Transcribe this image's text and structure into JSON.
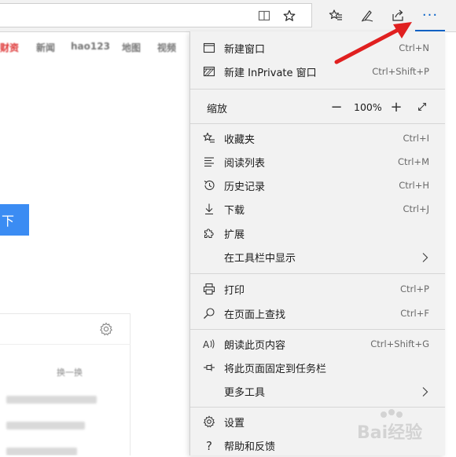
{
  "toolbar": {
    "icons": [
      "reading-view-icon",
      "favorite-star-icon",
      "favorites-hub-icon",
      "pen-icon",
      "share-icon",
      "more-icon"
    ],
    "more_label": "···"
  },
  "page": {
    "tabs": [
      "财资",
      "新闻",
      "hao123",
      "地图",
      "视频"
    ],
    "blue_button_label": "下",
    "refresh_label": "换一换"
  },
  "menu": {
    "items": [
      {
        "label": "新建窗口",
        "shortcut": "Ctrl+N",
        "icon": "window-icon"
      },
      {
        "label": "新建 InPrivate 窗口",
        "shortcut": "Ctrl+Shift+P",
        "icon": "inprivate-icon"
      },
      {
        "label": "收藏夹",
        "shortcut": "Ctrl+I",
        "icon": "favorites-icon"
      },
      {
        "label": "阅读列表",
        "shortcut": "Ctrl+M",
        "icon": "reading-list-icon"
      },
      {
        "label": "历史记录",
        "shortcut": "Ctrl+H",
        "icon": "history-icon"
      },
      {
        "label": "下载",
        "shortcut": "Ctrl+J",
        "icon": "download-icon"
      },
      {
        "label": "扩展",
        "shortcut": "",
        "icon": "extensions-icon"
      },
      {
        "label": "在工具栏中显示",
        "shortcut": "",
        "icon": ""
      },
      {
        "label": "打印",
        "shortcut": "Ctrl+P",
        "icon": "print-icon"
      },
      {
        "label": "在页面上查找",
        "shortcut": "Ctrl+F",
        "icon": "find-icon"
      },
      {
        "label": "朗读此页内容",
        "shortcut": "Ctrl+Shift+G",
        "icon": "read-aloud-icon"
      },
      {
        "label": "将此页面固定到任务栏",
        "shortcut": "",
        "icon": "pin-icon"
      },
      {
        "label": "更多工具",
        "shortcut": "",
        "icon": ""
      },
      {
        "label": "设置",
        "shortcut": "",
        "icon": "settings-icon"
      },
      {
        "label": "帮助和反馈",
        "shortcut": "",
        "icon": "help-icon"
      }
    ],
    "zoom": {
      "label": "缩放",
      "value": "100%",
      "minus": "−",
      "plus": "+"
    }
  },
  "watermark": {
    "text": "Bai经验"
  },
  "colors": {
    "accent": "#0a64c8",
    "arrow": "#e02020",
    "blue_button": "#3b8cf3",
    "menu_bg": "#f2f2f2"
  }
}
